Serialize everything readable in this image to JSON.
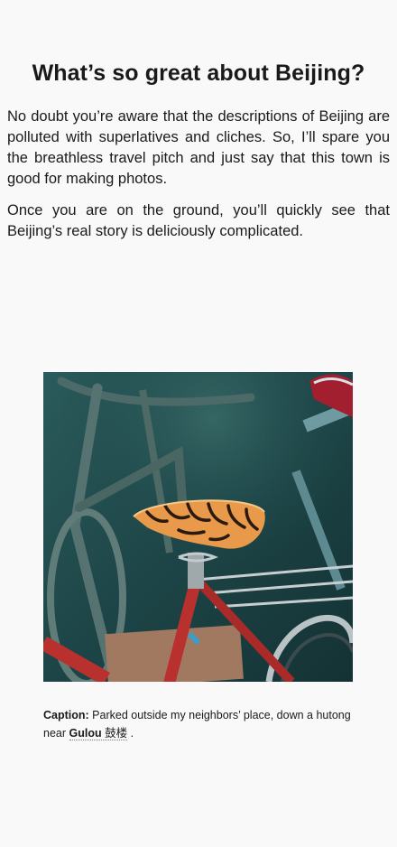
{
  "article": {
    "title": "What’s so great about Beijing?",
    "paragraphs": [
      "No doubt you’re aware that the descriptions of Beijing are polluted with superlatives and cliches. So, I’ll spare you the breathless travel pitch and just say that this town is good for making photos.",
      "Once you are on the ground, you’ll quickly see that Beijing’s real story is deliciously complicated."
    ]
  },
  "figure": {
    "caption_label": "Caption:",
    "caption_text": "Parked outside my neighbors’ place, down a hutong near",
    "place_name": "Gulou",
    "place_hanzi": "鼓楼",
    "caption_end": "."
  },
  "colors": {
    "background": "#f9f9f9",
    "text": "#1a1a1a",
    "photo_wall": "#1d4547",
    "bike_frame_red": "#b8312f",
    "saddle_orange": "#e89a4a"
  }
}
